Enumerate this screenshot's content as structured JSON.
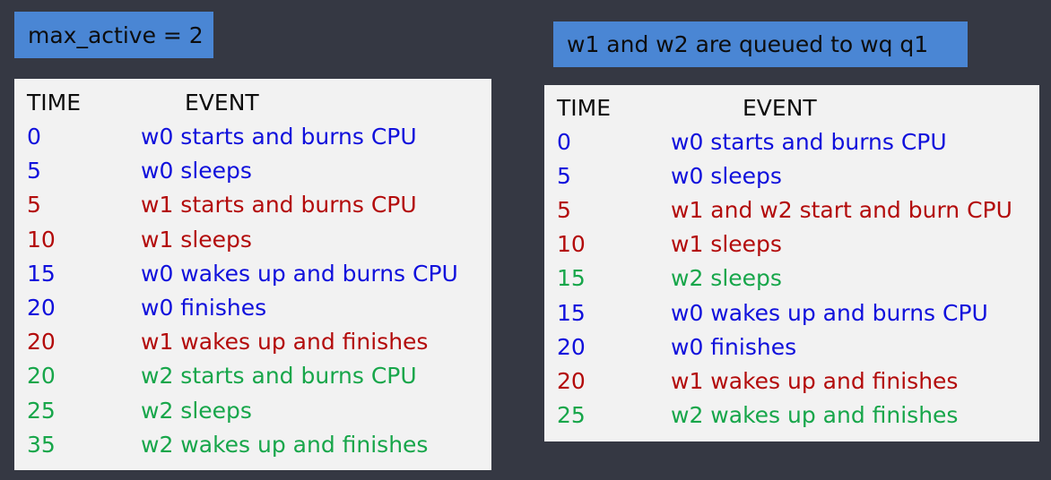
{
  "colors": {
    "background": "#353843",
    "label_box": "#4a86d4",
    "panel": "#f2f2f2",
    "w0": "#1010dc",
    "w1": "#b30b0b",
    "w2": "#17a64a"
  },
  "left": {
    "title": "max_active = 2",
    "header_time": "TIME",
    "header_event": "EVENT",
    "rows": [
      {
        "time": "0",
        "event": "w0 starts and burns CPU",
        "worker": "w0"
      },
      {
        "time": "5",
        "event": "w0 sleeps",
        "worker": "w0"
      },
      {
        "time": "5",
        "event": "w1 starts and burns CPU",
        "worker": "w1"
      },
      {
        "time": "10",
        "event": "w1 sleeps",
        "worker": "w1"
      },
      {
        "time": "15",
        "event": "w0 wakes up and burns CPU",
        "worker": "w0"
      },
      {
        "time": "20",
        "event": "w0 finishes",
        "worker": "w0"
      },
      {
        "time": "20",
        "event": "w1 wakes up and finishes",
        "worker": "w1"
      },
      {
        "time": "20",
        "event": "w2 starts and burns CPU",
        "worker": "w2"
      },
      {
        "time": "25",
        "event": "w2 sleeps",
        "worker": "w2"
      },
      {
        "time": "35",
        "event": "w2 wakes up and finishes",
        "worker": "w2"
      }
    ]
  },
  "right": {
    "title": "w1 and w2 are queued to wq q1",
    "header_time": "TIME",
    "header_event": "EVENT",
    "rows": [
      {
        "time": "0",
        "event": "w0 starts and burns CPU",
        "worker": "w0"
      },
      {
        "time": "5",
        "event": "w0 sleeps",
        "worker": "w0"
      },
      {
        "time": "5",
        "event": "w1 and w2 start and burn CPU",
        "worker": "w1"
      },
      {
        "time": "10",
        "event": "w1 sleeps",
        "worker": "w1"
      },
      {
        "time": "15",
        "event": "w2 sleeps",
        "worker": "w2"
      },
      {
        "time": "15",
        "event": "w0 wakes up and burns CPU",
        "worker": "w0"
      },
      {
        "time": "20",
        "event": "w0 finishes",
        "worker": "w0"
      },
      {
        "time": "20",
        "event": "w1 wakes up and finishes",
        "worker": "w1"
      },
      {
        "time": "25",
        "event": "w2 wakes up and finishes",
        "worker": "w2"
      }
    ]
  }
}
